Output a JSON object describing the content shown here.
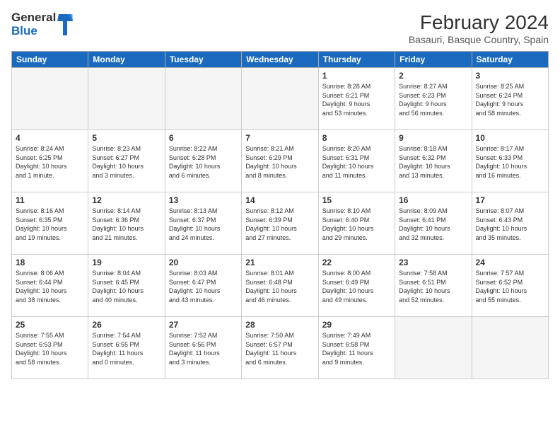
{
  "header": {
    "logo_general": "General",
    "logo_blue": "Blue",
    "month_title": "February 2024",
    "location": "Basauri, Basque Country, Spain"
  },
  "weekdays": [
    "Sunday",
    "Monday",
    "Tuesday",
    "Wednesday",
    "Thursday",
    "Friday",
    "Saturday"
  ],
  "weeks": [
    [
      {
        "day": "",
        "info": ""
      },
      {
        "day": "",
        "info": ""
      },
      {
        "day": "",
        "info": ""
      },
      {
        "day": "",
        "info": ""
      },
      {
        "day": "1",
        "info": "Sunrise: 8:28 AM\nSunset: 6:21 PM\nDaylight: 9 hours\nand 53 minutes."
      },
      {
        "day": "2",
        "info": "Sunrise: 8:27 AM\nSunset: 6:23 PM\nDaylight: 9 hours\nand 56 minutes."
      },
      {
        "day": "3",
        "info": "Sunrise: 8:25 AM\nSunset: 6:24 PM\nDaylight: 9 hours\nand 58 minutes."
      }
    ],
    [
      {
        "day": "4",
        "info": "Sunrise: 8:24 AM\nSunset: 6:25 PM\nDaylight: 10 hours\nand 1 minute."
      },
      {
        "day": "5",
        "info": "Sunrise: 8:23 AM\nSunset: 6:27 PM\nDaylight: 10 hours\nand 3 minutes."
      },
      {
        "day": "6",
        "info": "Sunrise: 8:22 AM\nSunset: 6:28 PM\nDaylight: 10 hours\nand 6 minutes."
      },
      {
        "day": "7",
        "info": "Sunrise: 8:21 AM\nSunset: 6:29 PM\nDaylight: 10 hours\nand 8 minutes."
      },
      {
        "day": "8",
        "info": "Sunrise: 8:20 AM\nSunset: 6:31 PM\nDaylight: 10 hours\nand 11 minutes."
      },
      {
        "day": "9",
        "info": "Sunrise: 8:18 AM\nSunset: 6:32 PM\nDaylight: 10 hours\nand 13 minutes."
      },
      {
        "day": "10",
        "info": "Sunrise: 8:17 AM\nSunset: 6:33 PM\nDaylight: 10 hours\nand 16 minutes."
      }
    ],
    [
      {
        "day": "11",
        "info": "Sunrise: 8:16 AM\nSunset: 6:35 PM\nDaylight: 10 hours\nand 19 minutes."
      },
      {
        "day": "12",
        "info": "Sunrise: 8:14 AM\nSunset: 6:36 PM\nDaylight: 10 hours\nand 21 minutes."
      },
      {
        "day": "13",
        "info": "Sunrise: 8:13 AM\nSunset: 6:37 PM\nDaylight: 10 hours\nand 24 minutes."
      },
      {
        "day": "14",
        "info": "Sunrise: 8:12 AM\nSunset: 6:39 PM\nDaylight: 10 hours\nand 27 minutes."
      },
      {
        "day": "15",
        "info": "Sunrise: 8:10 AM\nSunset: 6:40 PM\nDaylight: 10 hours\nand 29 minutes."
      },
      {
        "day": "16",
        "info": "Sunrise: 8:09 AM\nSunset: 6:41 PM\nDaylight: 10 hours\nand 32 minutes."
      },
      {
        "day": "17",
        "info": "Sunrise: 8:07 AM\nSunset: 6:43 PM\nDaylight: 10 hours\nand 35 minutes."
      }
    ],
    [
      {
        "day": "18",
        "info": "Sunrise: 8:06 AM\nSunset: 6:44 PM\nDaylight: 10 hours\nand 38 minutes."
      },
      {
        "day": "19",
        "info": "Sunrise: 8:04 AM\nSunset: 6:45 PM\nDaylight: 10 hours\nand 40 minutes."
      },
      {
        "day": "20",
        "info": "Sunrise: 8:03 AM\nSunset: 6:47 PM\nDaylight: 10 hours\nand 43 minutes."
      },
      {
        "day": "21",
        "info": "Sunrise: 8:01 AM\nSunset: 6:48 PM\nDaylight: 10 hours\nand 46 minutes."
      },
      {
        "day": "22",
        "info": "Sunrise: 8:00 AM\nSunset: 6:49 PM\nDaylight: 10 hours\nand 49 minutes."
      },
      {
        "day": "23",
        "info": "Sunrise: 7:58 AM\nSunset: 6:51 PM\nDaylight: 10 hours\nand 52 minutes."
      },
      {
        "day": "24",
        "info": "Sunrise: 7:57 AM\nSunset: 6:52 PM\nDaylight: 10 hours\nand 55 minutes."
      }
    ],
    [
      {
        "day": "25",
        "info": "Sunrise: 7:55 AM\nSunset: 6:53 PM\nDaylight: 10 hours\nand 58 minutes."
      },
      {
        "day": "26",
        "info": "Sunrise: 7:54 AM\nSunset: 6:55 PM\nDaylight: 11 hours\nand 0 minutes."
      },
      {
        "day": "27",
        "info": "Sunrise: 7:52 AM\nSunset: 6:56 PM\nDaylight: 11 hours\nand 3 minutes."
      },
      {
        "day": "28",
        "info": "Sunrise: 7:50 AM\nSunset: 6:57 PM\nDaylight: 11 hours\nand 6 minutes."
      },
      {
        "day": "29",
        "info": "Sunrise: 7:49 AM\nSunset: 6:58 PM\nDaylight: 11 hours\nand 9 minutes."
      },
      {
        "day": "",
        "info": ""
      },
      {
        "day": "",
        "info": ""
      }
    ]
  ]
}
